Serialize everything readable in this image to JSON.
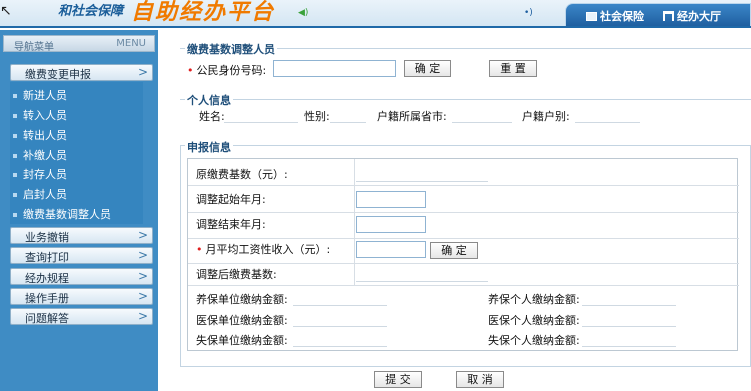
{
  "header": {
    "subtitle": "和社会保障",
    "title": "自助经办平台",
    "tabs": [
      {
        "label": "社会保险"
      },
      {
        "label": "经办大厅"
      }
    ]
  },
  "sidebar": {
    "heading": "导航菜单",
    "menu_label": "MENU",
    "groups": [
      {
        "label": "缴费变更申报"
      },
      {
        "label": "业务撤销"
      },
      {
        "label": "查询打印"
      },
      {
        "label": "经办规程"
      },
      {
        "label": "操作手册"
      },
      {
        "label": "问题解答"
      }
    ],
    "sub_items": [
      {
        "label": "新进人员"
      },
      {
        "label": "转入人员"
      },
      {
        "label": "转出人员"
      },
      {
        "label": "补缴人员"
      },
      {
        "label": "封存人员"
      },
      {
        "label": "启封人员"
      },
      {
        "label": "缴费基数调整人员"
      }
    ]
  },
  "query": {
    "section_title": "缴费基数调整人员",
    "id_label": "公民身份号码:",
    "id_value": "",
    "confirm_label": "确 定",
    "reset_label": "重 置"
  },
  "personal": {
    "section_title": "个人信息",
    "name_label": "姓名:",
    "gender_label": "性别:",
    "province_label": "户籍所属省市:",
    "household_label": "户籍户别:"
  },
  "report": {
    "section_title": "申报信息",
    "original_base_label": "原缴费基数（元）:",
    "start_month_label": "调整起始年月:",
    "end_month_label": "调整结束年月:",
    "monthly_income_label": "月平均工资性收入（元）:",
    "confirm_label": "确 定",
    "adjusted_base_label": "调整后缴费基数:",
    "pension_unit_label": "养保单位缴纳金额:",
    "pension_personal_label": "养保个人缴纳金额:",
    "medical_unit_label": "医保单位缴纳金额:",
    "medical_personal_label": "医保个人缴纳金额:",
    "unemp_unit_label": "失保单位缴纳金额:",
    "unemp_personal_label": "失保个人缴纳金额:"
  },
  "actions": {
    "submit_label": "提 交",
    "cancel_label": "取 消"
  }
}
